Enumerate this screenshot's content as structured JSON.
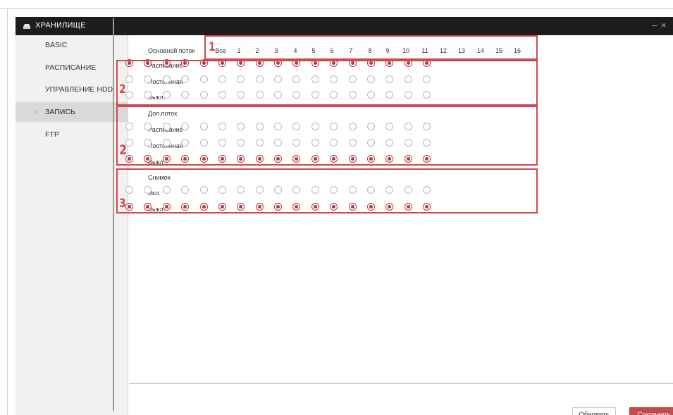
{
  "window": {
    "title": "ХРАНИЛИЩЕ",
    "minimize": "–",
    "close": "×"
  },
  "sidebar": {
    "items": [
      {
        "label": "BASIC",
        "active": false
      },
      {
        "label": "РАСПИСАНИЕ",
        "active": false
      },
      {
        "label": "УПРАВЛЕНИЕ HDD",
        "active": false
      },
      {
        "label": "ЗАПИСЬ",
        "active": true
      },
      {
        "label": "FTP",
        "active": false
      }
    ]
  },
  "header_label": "Основной поток",
  "columns": [
    "Все",
    "1",
    "2",
    "3",
    "4",
    "5",
    "6",
    "7",
    "8",
    "9",
    "10",
    "11",
    "12",
    "13",
    "14",
    "15",
    "16"
  ],
  "main_stream": {
    "rows": [
      {
        "label": "Расписание",
        "checked": true
      },
      {
        "label": "Постоянная",
        "checked": false
      },
      {
        "label": "Выкл.",
        "checked": false
      }
    ]
  },
  "sub_stream": {
    "title": "Доп.поток",
    "rows": [
      {
        "label": "Расписание",
        "checked": false
      },
      {
        "label": "Постоянная",
        "checked": false
      },
      {
        "label": "Выкл.",
        "checked": true
      }
    ]
  },
  "snapshot": {
    "title": "Снимок",
    "rows": [
      {
        "label": "Вкл.",
        "checked": false
      },
      {
        "label": "Выкл.",
        "checked": true
      }
    ]
  },
  "annotations": {
    "marker_1": "1",
    "marker_2": "2",
    "marker_3": "3"
  },
  "buttons": {
    "refresh": "Обновить",
    "save": "Сохранить"
  },
  "colors": {
    "titlebar": "#1d1d1d",
    "accent": "#c24c4c",
    "annotation": "#d2474d"
  },
  "icons": {
    "app": "storage-icon",
    "chevron": "chevron-right-icon"
  }
}
